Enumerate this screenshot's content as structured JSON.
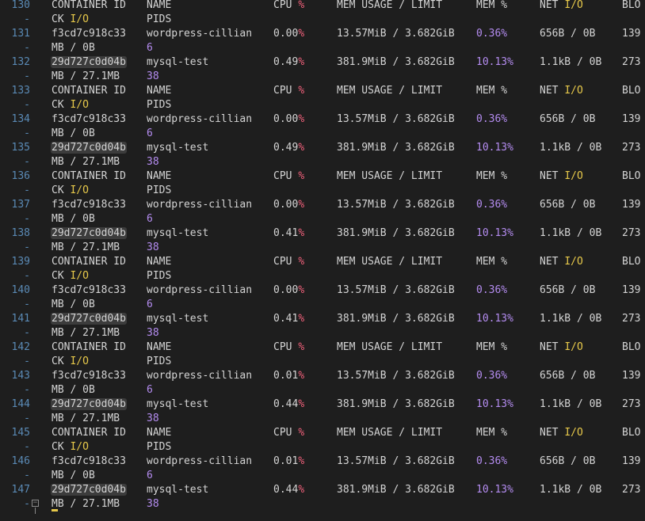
{
  "header": {
    "container_id": "CONTAINER ID",
    "name": "NAME",
    "cpu": "CPU ",
    "cpu_pct": "%",
    "mem_usage": "MEM USAGE / LIMIT",
    "mem_pct": "MEM %",
    "net": "NET ",
    "net_io": "I/O",
    "blo": "BLO",
    "wrap_ck": "CK ",
    "wrap_io": "I/O",
    "pids": "PIDS"
  },
  "wrap_marker": "-",
  "wordpress": {
    "id": "f3cd7c918c33",
    "name": "wordpress-cillian",
    "mem_usage": "13.57MiB / 3.682GiB",
    "mem_pct": "0.36%",
    "net": "656B / 0B",
    "block": "139",
    "block_wrap": "MB / 0B",
    "pids": "6"
  },
  "mysql": {
    "id": "29d727c0d04b",
    "name": "mysql-test",
    "mem_usage": "381.9MiB / 3.682GiB",
    "mem_pct": "10.13%",
    "net": "1.1kB / 0B",
    "block": "273",
    "block_wrap": "MB / 27.1MB",
    "pids": "38"
  },
  "lines": [
    {
      "n": "130",
      "type": "header"
    },
    {
      "n": "131",
      "type": "wordpress",
      "cpu": "0.00"
    },
    {
      "n": "132",
      "type": "mysql",
      "cpu": "0.49"
    },
    {
      "n": "133",
      "type": "header"
    },
    {
      "n": "134",
      "type": "wordpress",
      "cpu": "0.00"
    },
    {
      "n": "135",
      "type": "mysql",
      "cpu": "0.49"
    },
    {
      "n": "136",
      "type": "header"
    },
    {
      "n": "137",
      "type": "wordpress",
      "cpu": "0.00"
    },
    {
      "n": "138",
      "type": "mysql",
      "cpu": "0.41"
    },
    {
      "n": "139",
      "type": "header"
    },
    {
      "n": "140",
      "type": "wordpress",
      "cpu": "0.00"
    },
    {
      "n": "141",
      "type": "mysql",
      "cpu": "0.41"
    },
    {
      "n": "142",
      "type": "header"
    },
    {
      "n": "143",
      "type": "wordpress",
      "cpu": "0.01"
    },
    {
      "n": "144",
      "type": "mysql",
      "cpu": "0.44"
    },
    {
      "n": "145",
      "type": "header"
    },
    {
      "n": "146",
      "type": "wordpress",
      "cpu": "0.01"
    },
    {
      "n": "147",
      "type": "mysql",
      "cpu": "0.44"
    }
  ],
  "colors": {
    "background": "#1e1e1e",
    "text": "#d4d4d4",
    "line_number": "#5a8ab5",
    "percent_red": "#f0607a",
    "io_yellow": "#e6c84a",
    "number_purple": "#b48cf0"
  }
}
